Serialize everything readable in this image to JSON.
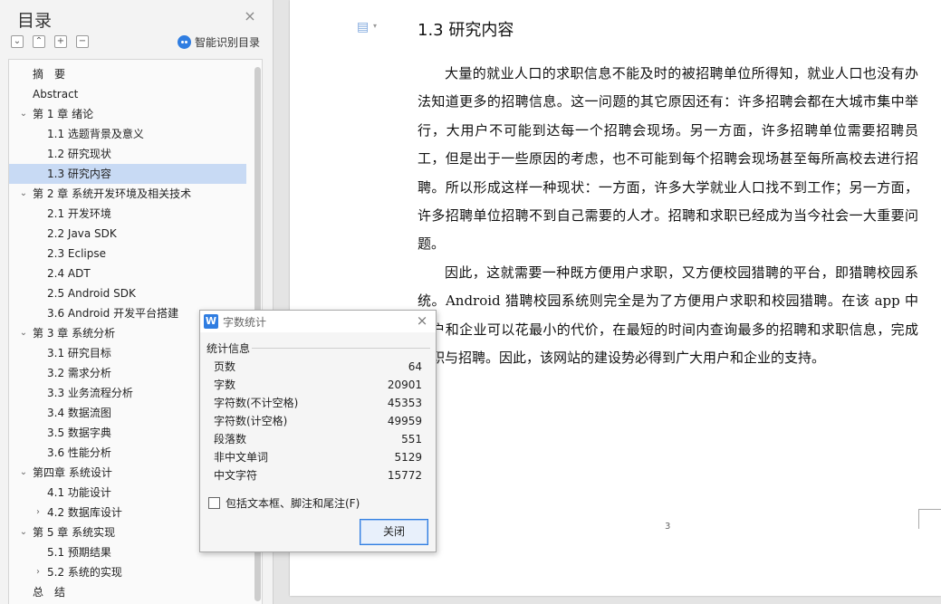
{
  "nav": {
    "title": "目录",
    "close_icon": "×",
    "toolbar": [
      {
        "name": "collapse-all-button",
        "glyph": "⌄"
      },
      {
        "name": "expand-all-button",
        "glyph": "⌃"
      },
      {
        "name": "add-heading-button",
        "glyph": "+"
      },
      {
        "name": "remove-heading-button",
        "glyph": "−"
      }
    ],
    "smart_label": "智能识别目录",
    "toc": [
      {
        "label": "摘　要",
        "level": 0,
        "arrow": ""
      },
      {
        "label": "Abstract",
        "level": 0,
        "arrow": ""
      },
      {
        "label": "第 1 章  绪论",
        "level": 0,
        "arrow": "⌄"
      },
      {
        "label": "1.1 选题背景及意义",
        "level": 1,
        "arrow": ""
      },
      {
        "label": "1.2 研究现状",
        "level": 1,
        "arrow": ""
      },
      {
        "label": "1.3  研究内容",
        "level": 1,
        "arrow": "",
        "active": true
      },
      {
        "label": "第 2 章  系统开发环境及相关技术",
        "level": 0,
        "arrow": "⌄"
      },
      {
        "label": "2.1 开发环境",
        "level": 1,
        "arrow": ""
      },
      {
        "label": "2.2 Java SDK",
        "level": 1,
        "arrow": ""
      },
      {
        "label": "2.3 Eclipse",
        "level": 1,
        "arrow": ""
      },
      {
        "label": "2.4 ADT",
        "level": 1,
        "arrow": ""
      },
      {
        "label": "2.5 Android SDK",
        "level": 1,
        "arrow": ""
      },
      {
        "label": "3.6 Android 开发平台搭建",
        "level": 1,
        "arrow": ""
      },
      {
        "label": "第 3 章  系统分析",
        "level": 0,
        "arrow": "⌄"
      },
      {
        "label": "3.1  研究目标",
        "level": 1,
        "arrow": ""
      },
      {
        "label": "3.2  需求分析",
        "level": 1,
        "arrow": ""
      },
      {
        "label": "3.3  业务流程分析",
        "level": 1,
        "arrow": ""
      },
      {
        "label": "3.4  数据流图",
        "level": 1,
        "arrow": ""
      },
      {
        "label": "3.5  数据字典",
        "level": 1,
        "arrow": ""
      },
      {
        "label": "3.6  性能分析",
        "level": 1,
        "arrow": ""
      },
      {
        "label": "第四章  系统设计",
        "level": 0,
        "arrow": "⌄"
      },
      {
        "label": "4.1  功能设计",
        "level": 1,
        "arrow": ""
      },
      {
        "label": "4.2  数据库设计",
        "level": 1,
        "arrow": "›"
      },
      {
        "label": "第 5 章  系统实现",
        "level": 0,
        "arrow": "⌄"
      },
      {
        "label": "5.1 预期结果",
        "level": 1,
        "arrow": ""
      },
      {
        "label": "5.2 系统的实现",
        "level": 1,
        "arrow": "›"
      },
      {
        "label": "总　结",
        "level": 0,
        "arrow": ""
      }
    ]
  },
  "document": {
    "heading": "1.3  研究内容",
    "paragraphs": [
      "大量的就业人口的求职信息不能及时的被招聘单位所得知，就业人口也没有办法知道更多的招聘信息。这一问题的其它原因还有：许多招聘会都在大城市集中举行，大用户不可能到达每一个招聘会现场。另一方面，许多招聘单位需要招聘员工，但是出于一些原因的考虑，也不可能到每个招聘会现场甚至每所高校去进行招聘。所以形成这样一种现状：一方面，许多大学就业人口找不到工作；另一方面，许多招聘单位招聘不到自己需要的人才。招聘和求职已经成为当今社会一大重要问题。",
      "因此，这就需要一种既方便用户求职，又方便校园猎聘的平台，即猎聘校园系统。Android 猎聘校园系统则完全是为了方便用户求职和校园猎聘。在该 app 中用户和企业可以花最小的代价，在最短的时间内查询最多的招聘和求职信息，完成求职与招聘。因此，该网站的建设势必得到广大用户和企业的支持。"
    ],
    "page_number": "3"
  },
  "dialog": {
    "title": "字数统计",
    "app_icon_letter": "W",
    "group_label": "统计信息",
    "stats": [
      {
        "label": "页数",
        "value": "64"
      },
      {
        "label": "字数",
        "value": "20901"
      },
      {
        "label": "字符数(不计空格)",
        "value": "45353"
      },
      {
        "label": "字符数(计空格)",
        "value": "49959"
      },
      {
        "label": "段落数",
        "value": "551"
      },
      {
        "label": "非中文单词",
        "value": "5129"
      },
      {
        "label": "中文字符",
        "value": "15772"
      }
    ],
    "checkbox_label": "包括文本框、脚注和尾注(F)",
    "checkbox_checked": false,
    "close_button": "关闭"
  },
  "colors": {
    "accent": "#2f7de1",
    "toc_active": "#c8daf4"
  }
}
